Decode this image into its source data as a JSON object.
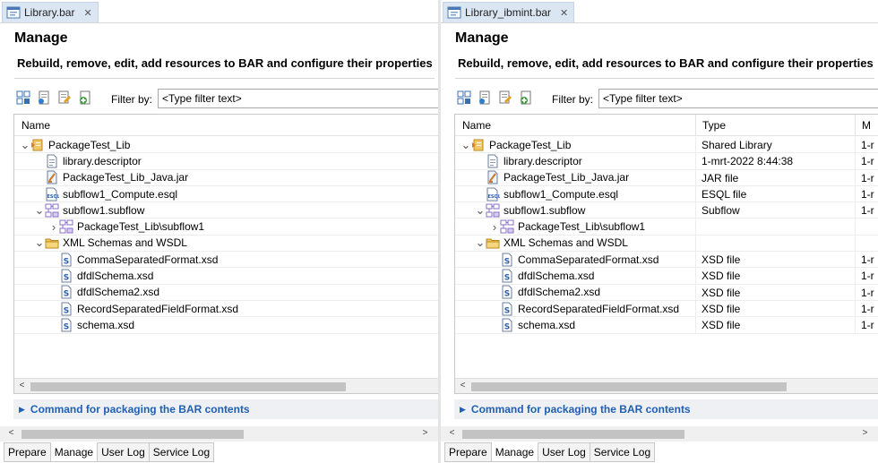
{
  "left": {
    "tab_title": "Library.bar",
    "manage_title": "Manage",
    "description": "Rebuild, remove, edit, add resources to BAR and configure their properties",
    "filter_label": "Filter by:",
    "filter_value": "<Type filter text>",
    "columns": [
      "Name"
    ],
    "rows": [
      {
        "level": 0,
        "twisty": "v",
        "icon": "library-icon",
        "name": "PackageTest_Lib"
      },
      {
        "level": 1,
        "twisty": "",
        "icon": "descriptor-file-icon",
        "name": "library.descriptor"
      },
      {
        "level": 1,
        "twisty": "",
        "icon": "jar-file-icon",
        "name": "PackageTest_Lib_Java.jar"
      },
      {
        "level": 1,
        "twisty": "",
        "icon": "esql-file-icon",
        "name": "subflow1_Compute.esql"
      },
      {
        "level": 1,
        "twisty": "v",
        "icon": "subflow-icon",
        "name": "subflow1.subflow"
      },
      {
        "level": 2,
        "twisty": ">",
        "icon": "subflow-icon",
        "name": "PackageTest_Lib\\subflow1"
      },
      {
        "level": 1,
        "twisty": "v",
        "icon": "folder-icon",
        "name": "XML Schemas and WSDL"
      },
      {
        "level": 2,
        "twisty": "",
        "icon": "xsd-file-icon",
        "name": "CommaSeparatedFormat.xsd"
      },
      {
        "level": 2,
        "twisty": "",
        "icon": "xsd-file-icon",
        "name": "dfdlSchema.xsd"
      },
      {
        "level": 2,
        "twisty": "",
        "icon": "xsd-file-icon",
        "name": "dfdlSchema2.xsd"
      },
      {
        "level": 2,
        "twisty": "",
        "icon": "xsd-file-icon",
        "name": "RecordSeparatedFieldFormat.xsd"
      },
      {
        "level": 2,
        "twisty": "",
        "icon": "xsd-file-icon",
        "name": "schema.xsd"
      }
    ],
    "command_section": "Command for packaging the BAR contents",
    "bottom_tabs": [
      "Prepare",
      "Manage",
      "User Log",
      "Service Log"
    ],
    "active_tab": "Manage"
  },
  "right": {
    "tab_title": "Library_ibmint.bar",
    "manage_title": "Manage",
    "description": "Rebuild, remove, edit, add resources to BAR and configure their properties",
    "filter_label": "Filter by:",
    "filter_value": "<Type filter text>",
    "columns": [
      "Name",
      "Type",
      "M"
    ],
    "rows": [
      {
        "level": 0,
        "twisty": "v",
        "icon": "library-icon",
        "name": "PackageTest_Lib",
        "type": "Shared Library",
        "m": "1-r"
      },
      {
        "level": 1,
        "twisty": "",
        "icon": "descriptor-file-icon",
        "name": "library.descriptor",
        "type": "1-mrt-2022  8:44:38",
        "m": "1-r"
      },
      {
        "level": 1,
        "twisty": "",
        "icon": "jar-file-icon",
        "name": "PackageTest_Lib_Java.jar",
        "type": "JAR file",
        "m": "1-r"
      },
      {
        "level": 1,
        "twisty": "",
        "icon": "esql-file-icon",
        "name": "subflow1_Compute.esql",
        "type": "ESQL file",
        "m": "1-r"
      },
      {
        "level": 1,
        "twisty": "v",
        "icon": "subflow-icon",
        "name": "subflow1.subflow",
        "type": "Subflow",
        "m": "1-r"
      },
      {
        "level": 2,
        "twisty": ">",
        "icon": "subflow-icon",
        "name": "PackageTest_Lib\\subflow1",
        "type": "",
        "m": ""
      },
      {
        "level": 1,
        "twisty": "v",
        "icon": "folder-icon",
        "name": "XML Schemas and WSDL",
        "type": "",
        "m": ""
      },
      {
        "level": 2,
        "twisty": "",
        "icon": "xsd-file-icon",
        "name": "CommaSeparatedFormat.xsd",
        "type": "XSD file",
        "m": "1-r"
      },
      {
        "level": 2,
        "twisty": "",
        "icon": "xsd-file-icon",
        "name": "dfdlSchema.xsd",
        "type": "XSD file",
        "m": "1-r"
      },
      {
        "level": 2,
        "twisty": "",
        "icon": "xsd-file-icon",
        "name": "dfdlSchema2.xsd",
        "type": "XSD file",
        "m": "1-r"
      },
      {
        "level": 2,
        "twisty": "",
        "icon": "xsd-file-icon",
        "name": "RecordSeparatedFieldFormat.xsd",
        "type": "XSD file",
        "m": "1-r"
      },
      {
        "level": 2,
        "twisty": "",
        "icon": "xsd-file-icon",
        "name": "schema.xsd",
        "type": "XSD file",
        "m": "1-r"
      }
    ],
    "command_section": "Command for packaging the BAR contents",
    "bottom_tabs": [
      "Prepare",
      "Manage",
      "User Log",
      "Service Log"
    ],
    "active_tab": "Manage"
  },
  "colors": {
    "link_blue": "#1f5fb4",
    "tab_active_bg": "#dbe6f3",
    "section_bg": "#eef0f3"
  }
}
